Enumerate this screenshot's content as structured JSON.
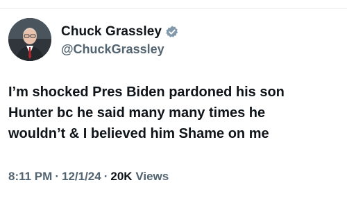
{
  "author": {
    "display_name": "Chuck Grassley",
    "handle": "@ChuckGrassley",
    "verified_icon": "verified-badge-icon",
    "badge_color": "#829aab"
  },
  "tweet": {
    "text_lines": [
      "I’m shocked Pres Biden pardoned his son",
      "Hunter bc he said many many times he",
      "wouldn’t & I believed him Shame on me"
    ]
  },
  "meta": {
    "time": "8:11 PM",
    "separator": "·",
    "date": "12/1/24",
    "views_count": "20K",
    "views_label": "Views"
  },
  "colors": {
    "text_primary": "#0f1419",
    "text_secondary": "#536471"
  }
}
